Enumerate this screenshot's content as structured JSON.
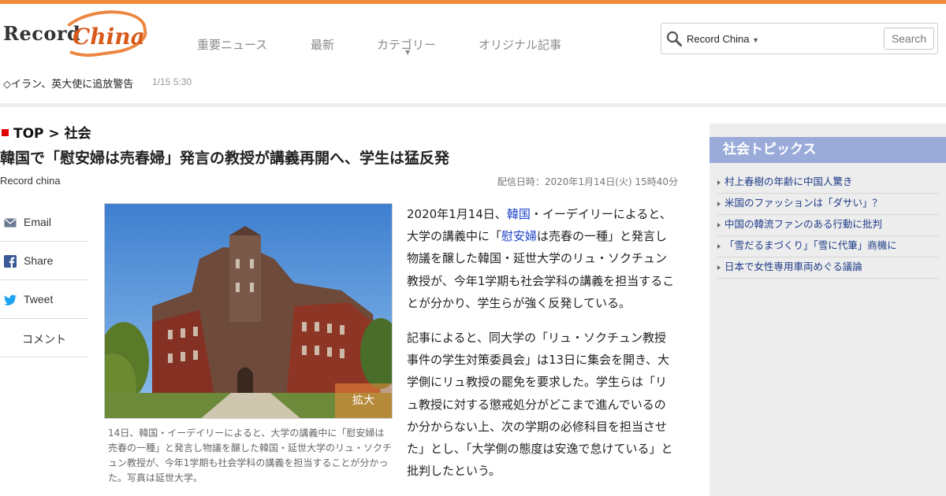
{
  "header": {
    "logo_text_1": "Record",
    "logo_text_2": "China",
    "nav": [
      "重要ニュース",
      "最新",
      "カテゴリー",
      "オリジナル記事"
    ],
    "search": {
      "scope": "Record China",
      "button_label": "Search",
      "value": ""
    }
  },
  "ticker": {
    "headline": "◇イラン、英大使に追放警告",
    "time": "1/15 5:30"
  },
  "article": {
    "breadcrumb_top": "TOP",
    "breadcrumb_sep": ">",
    "breadcrumb_section": "社会",
    "title": "韓国で「慰安婦は売春婦」発言の教授が講義再開へ、学生は猛反発",
    "source": "Record china",
    "published": "配信日時：2020年1月14日(火) 15時40分",
    "zoom_label": "拡大",
    "caption": "14日、韓国・イーデイリーによると、大学の講義中に「慰安婦は売春の一種」と発言し物議を醸した韓国・延世大学のリュ・ソクチュン教授が、今年1学期も社会学科の講義を担当することが分かった。写真は延世大学。",
    "p1_a": "2020年1月14日、",
    "p1_link1": "韓国",
    "p1_b": "・イーデイリーによると、大学の講義中に「",
    "p1_link2": "慰安婦",
    "p1_c": "は売春の一種」と発言し物議を醸した韓国・延世大学のリュ・ソクチュン教授が、今年1学期も社会学科の講義を担当することが分かり、学生らが強く反発している。",
    "p2": "記事によると、同大学の「リュ・ソクチュン教授事件の学生対策委員会」は13日に集会を開き、大学側にリュ教授の罷免を要求した。学生らは「リュ教授に対する懲戒処分がどこまで進んでいるのか分からない上、次の学期の必修科目を担当させた」とし、「大学側の態度は安逸で怠けている」と批判したという。"
  },
  "share": [
    {
      "label": "Email",
      "icon": "mail-icon"
    },
    {
      "label": "Share",
      "icon": "facebook-icon"
    },
    {
      "label": "Tweet",
      "icon": "twitter-icon"
    },
    {
      "label": "コメント",
      "icon": ""
    }
  ],
  "sidebar": {
    "heading": "社会トピックス",
    "items": [
      "村上春樹の年齢に中国人驚き",
      "米国のファッションは「ダサい」？",
      "中国の韓流ファンのある行動に批判",
      "「雪だるまづくり」「雪に代筆」商機に",
      "日本で女性専用車両めぐる議論"
    ]
  },
  "colors": {
    "accent_orange": "#f08a3a",
    "sidebar_head": "#9aabd9",
    "link_blue": "#1a3fc7",
    "crumb_red": "#e00000"
  }
}
